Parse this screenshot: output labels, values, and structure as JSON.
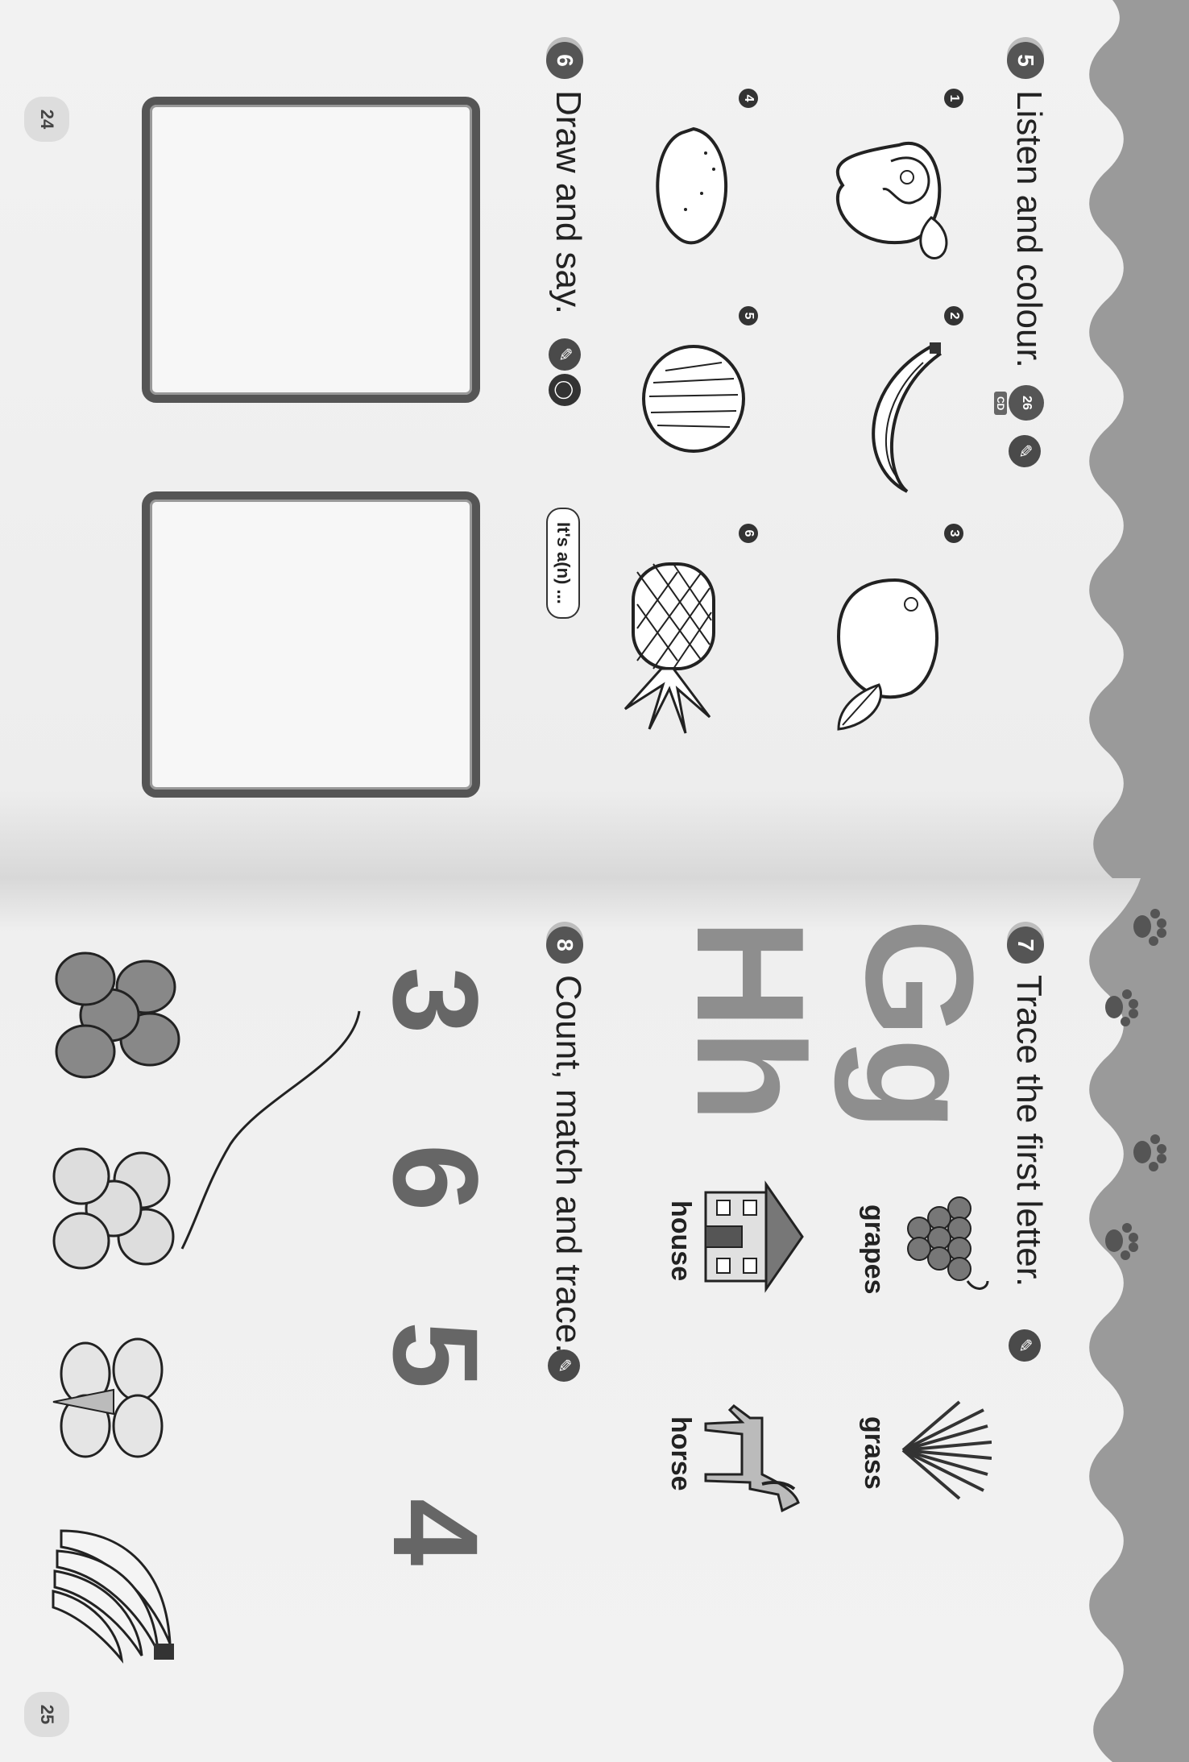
{
  "left_page": {
    "exercise5": {
      "number": "5",
      "instruction": "Listen and colour.",
      "cd_track": "26",
      "cd_label": "CD"
    },
    "item_numbers": [
      "1",
      "2",
      "3",
      "4",
      "5",
      "6"
    ],
    "fruit_icons": [
      "apple-icon",
      "banana-icon",
      "mango-icon",
      "lemon-icon",
      "coconut-icon",
      "pineapple-icon"
    ],
    "exercise6": {
      "number": "6",
      "instruction": "Draw and say.",
      "speech": "It's a(n) ..."
    },
    "page_number": "24"
  },
  "right_page": {
    "exercise7": {
      "number": "7",
      "instruction": "Trace the first letter.",
      "letters": [
        "Gg",
        "Hh"
      ],
      "words": [
        "grapes",
        "grass",
        "house",
        "horse"
      ]
    },
    "exercise8": {
      "number": "8",
      "instruction": "Count, match and trace.",
      "numbers": [
        "3",
        "6",
        "5",
        "4"
      ],
      "groups": [
        "coconuts",
        "apples",
        "mangoes",
        "bananas"
      ]
    },
    "page_number": "25"
  },
  "colors": {
    "page": "#f1f1f1",
    "ink": "#222222",
    "accent_grey": "#8e8e8e",
    "background": "#2f8a2f"
  }
}
